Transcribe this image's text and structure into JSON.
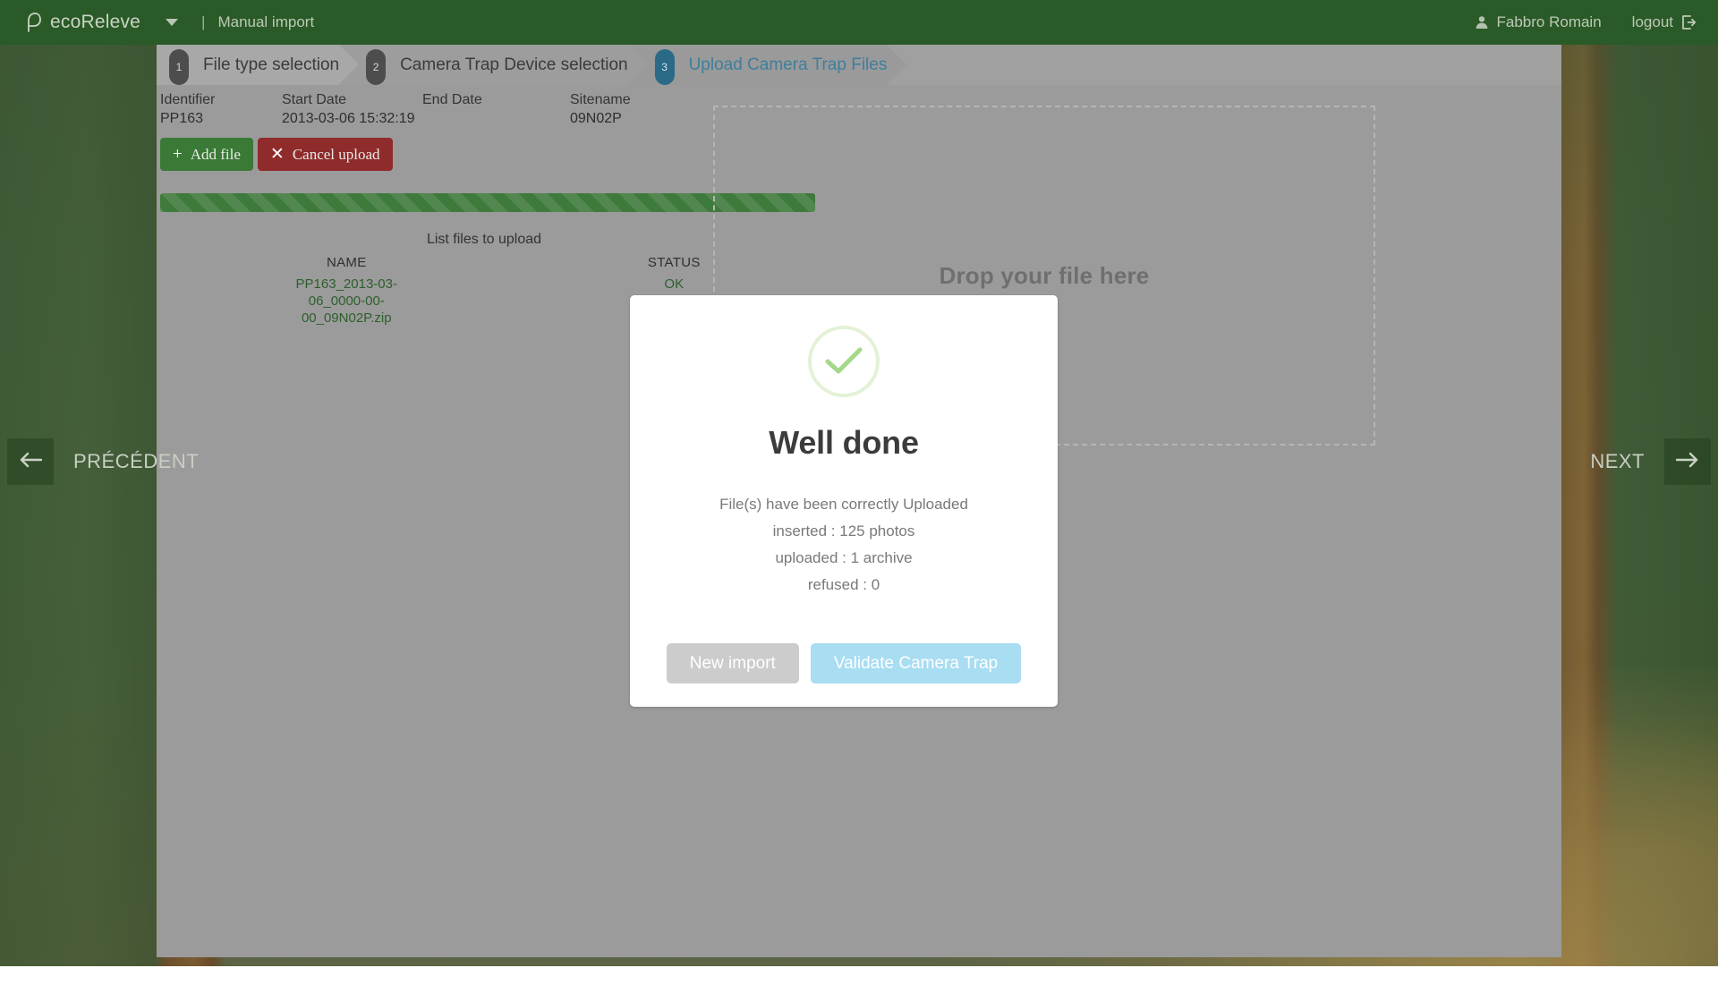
{
  "header": {
    "brand": "ecoReleve",
    "brand_logo_icon": "leaf-drop-icon",
    "dropdown_icon": "chevron-down-icon",
    "divider": "|",
    "section": "Manual import",
    "user_icon": "user-icon",
    "user_name": "Fabbro Romain",
    "logout_label": "logout",
    "logout_icon": "logout-icon",
    "bar_color": "#2a5a27"
  },
  "sidenav": {
    "prev_label": "PRÉCÉDENT",
    "prev_icon": "arrow-left-icon",
    "next_label": "NEXT",
    "next_icon": "arrow-right-icon"
  },
  "steps": [
    {
      "number": "1",
      "label": "File type selection",
      "active": false
    },
    {
      "number": "2",
      "label": "Camera Trap Device selection",
      "active": false
    },
    {
      "number": "3",
      "label": "Upload Camera Trap Files",
      "active": true
    }
  ],
  "step_active_color": "#2a6a86",
  "meta": {
    "identifier_label": "Identifier",
    "identifier_value": "PP163",
    "start_date_label": "Start Date",
    "start_date_value": "2013-03-06 15:32:19",
    "end_date_label": "End Date",
    "end_date_value": "",
    "sitename_label": "Sitename",
    "sitename_value": "09N02P"
  },
  "toolbar": {
    "add_file_label": "Add  file",
    "add_file_icon": "plus-icon",
    "add_file_color": "#3a7a36",
    "cancel_upload_label": "Cancel  upload",
    "cancel_upload_icon": "close-x-icon",
    "cancel_upload_color": "#8f2b2b"
  },
  "progress": {
    "percent": 100,
    "color": "#3e7a3b",
    "striped": true
  },
  "file_list": {
    "title": "List files to upload",
    "columns": [
      "NAME",
      "STATUS"
    ],
    "rows": [
      {
        "name": "PP163_2013-03-06_0000-00-00_09N02P.zip",
        "status": "OK"
      }
    ],
    "row_text_color": "#2e5f2c"
  },
  "dropzone": {
    "text": "Drop your file here"
  },
  "modal": {
    "icon": "check-circle-icon",
    "icon_color": "#a5d98a",
    "title": "Well done",
    "lines": [
      "File(s) have been correctly Uploaded",
      "inserted : 125 photos",
      "uploaded : 1 archive",
      "refused : 0"
    ],
    "body_text": "File(s) have been correctly Uploaded\ninserted : 125 photos\nuploaded : 1 archive\nrefused : 0",
    "buttons": {
      "new_import_label": "New import",
      "new_import_color": "#cccccc",
      "validate_label": "Validate Camera Trap",
      "validate_color": "#a8ddf2"
    }
  }
}
